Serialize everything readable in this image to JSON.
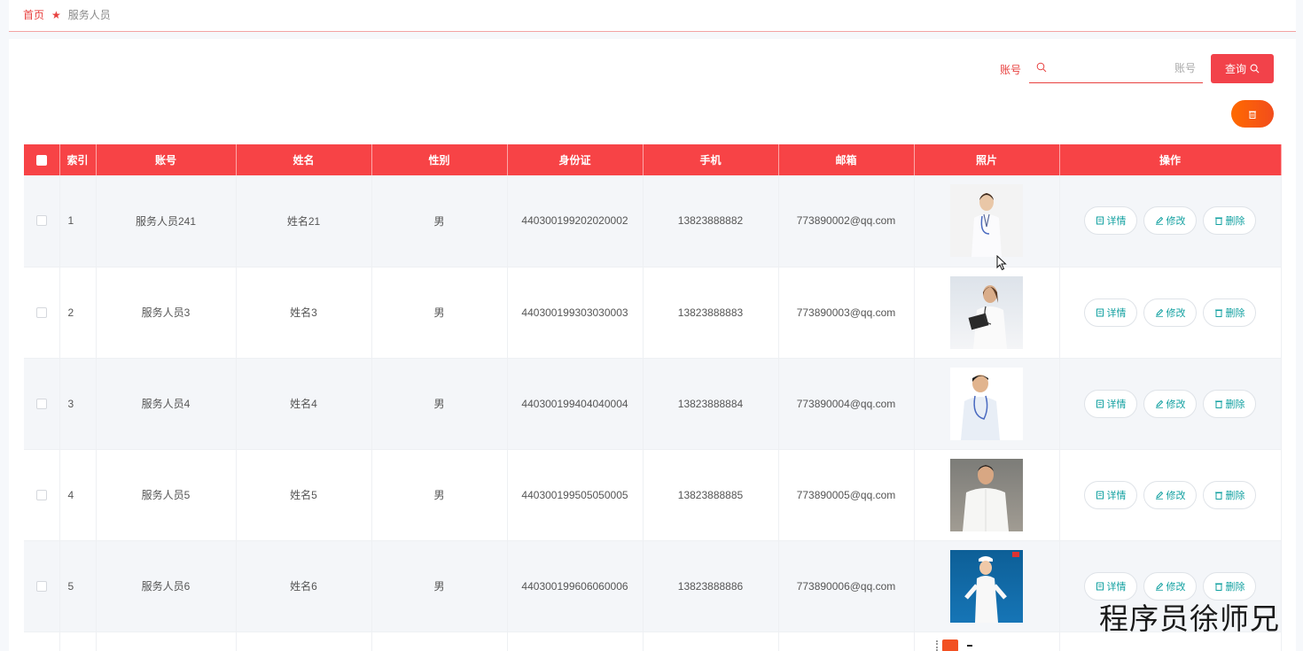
{
  "breadcrumb": {
    "home": "首页",
    "current": "服务人员"
  },
  "search": {
    "label": "账号",
    "placeholder": "账号",
    "query_label": "查询"
  },
  "table": {
    "headers": [
      "索引",
      "账号",
      "姓名",
      "性别",
      "身份证",
      "手机",
      "邮箱",
      "照片",
      "操作"
    ],
    "rows": [
      {
        "index": "1",
        "account": "服务人员241",
        "name": "姓名21",
        "gender": "男",
        "id_card": "440300199202020002",
        "phone": "13823888882",
        "email": "773890002@qq.com"
      },
      {
        "index": "2",
        "account": "服务人员3",
        "name": "姓名3",
        "gender": "男",
        "id_card": "440300199303030003",
        "phone": "13823888883",
        "email": "773890003@qq.com"
      },
      {
        "index": "3",
        "account": "服务人员4",
        "name": "姓名4",
        "gender": "男",
        "id_card": "440300199404040004",
        "phone": "13823888884",
        "email": "773890004@qq.com"
      },
      {
        "index": "4",
        "account": "服务人员5",
        "name": "姓名5",
        "gender": "男",
        "id_card": "440300199505050005",
        "phone": "13823888885",
        "email": "773890005@qq.com"
      },
      {
        "index": "5",
        "account": "服务人员6",
        "name": "姓名6",
        "gender": "男",
        "id_card": "440300199606060006",
        "phone": "13823888886",
        "email": "773890006@qq.com"
      }
    ],
    "actions": {
      "detail": "详情",
      "edit": "修改",
      "delete": "删除"
    }
  },
  "watermark": "程序员徐师兄",
  "colors": {
    "accent": "#f74346",
    "action_text": "#11a0a0",
    "delete_gradient": "#ff6a00"
  },
  "icons": [
    "star-icon",
    "search-icon",
    "trash-icon",
    "detail-icon",
    "edit-icon",
    "delete-icon",
    "mouse-cursor-icon"
  ]
}
